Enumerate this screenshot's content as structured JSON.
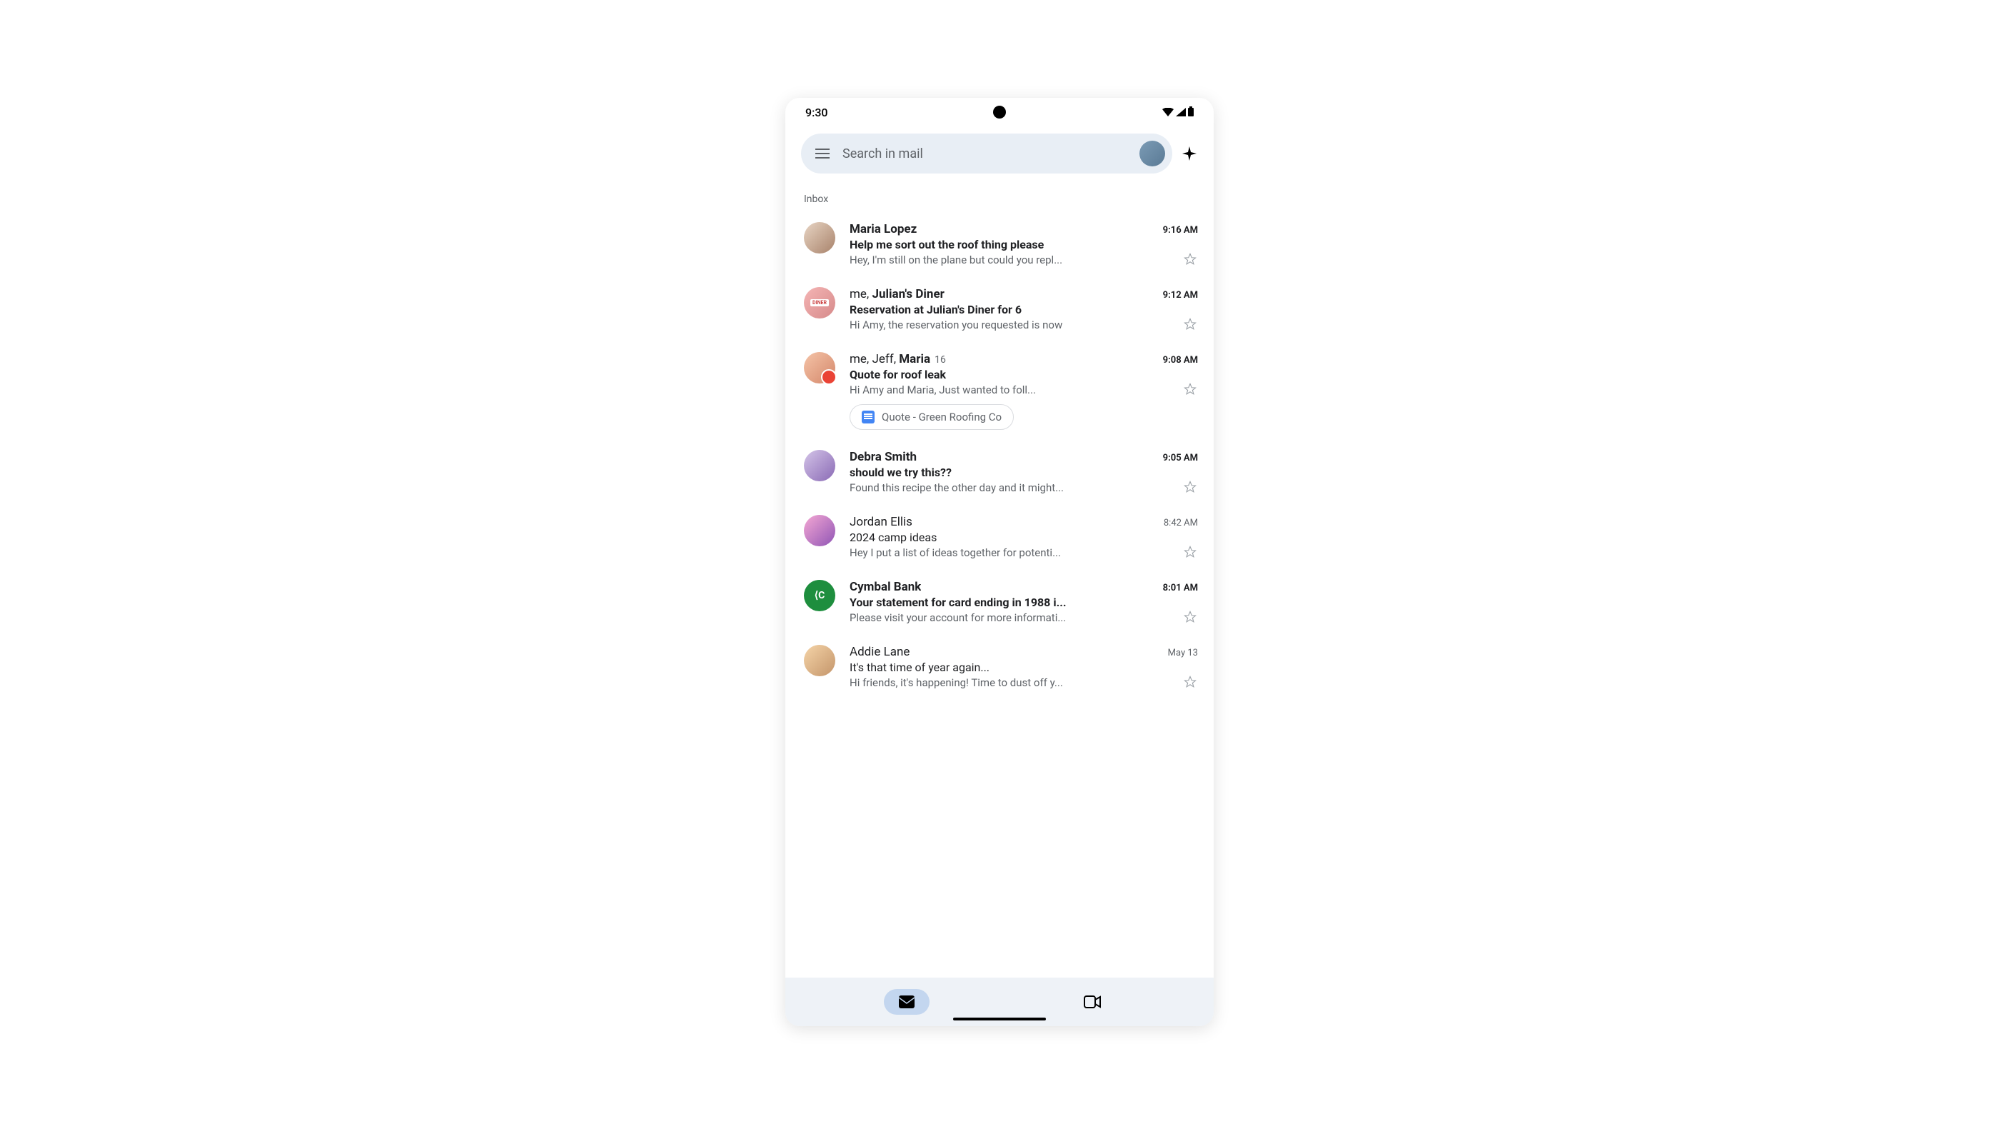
{
  "status": {
    "time": "9:30"
  },
  "search": {
    "placeholder": "Search in mail"
  },
  "section_label": "Inbox",
  "emails": [
    {
      "sender": "Maria Lopez",
      "sender_prefix": "",
      "thread_count": "",
      "time": "9:16 AM",
      "subject": "Help me sort out the roof thing please",
      "snippet": "Hey, I'm still on the plane but could you repl...",
      "unread": true,
      "starred": false,
      "attachment": null
    },
    {
      "sender": "Julian's Diner",
      "sender_prefix": "me, ",
      "thread_count": "",
      "time": "9:12 AM",
      "subject": "Reservation at Julian's Diner for 6",
      "snippet": "Hi Amy, the reservation you requested is now",
      "unread": true,
      "starred": false,
      "attachment": null
    },
    {
      "sender": "Maria",
      "sender_prefix": "me, Jeff, ",
      "thread_count": "16",
      "time": "9:08 AM",
      "subject": "Quote for roof leak",
      "snippet": "Hi Amy and Maria, Just wanted to foll...",
      "unread": true,
      "starred": false,
      "attachment": "Quote - Green Roofing Co"
    },
    {
      "sender": "Debra Smith",
      "sender_prefix": "",
      "thread_count": "",
      "time": "9:05 AM",
      "subject": "should we try this??",
      "snippet": "Found this recipe the other day and it might...",
      "unread": true,
      "starred": false,
      "attachment": null
    },
    {
      "sender": "Jordan Ellis",
      "sender_prefix": "",
      "thread_count": "",
      "time": "8:42 AM",
      "subject": "2024 camp ideas",
      "snippet": "Hey I put a list of ideas together for potenti...",
      "unread": false,
      "starred": false,
      "attachment": null
    },
    {
      "sender": "Cymbal Bank",
      "sender_prefix": "",
      "thread_count": "",
      "time": "8:01 AM",
      "subject": "Your statement for card ending in 1988 i...",
      "snippet": "Please visit your account for more informati...",
      "unread": true,
      "starred": false,
      "attachment": null
    },
    {
      "sender": "Addie Lane",
      "sender_prefix": "",
      "thread_count": "",
      "time": "May 13",
      "subject": "It's that time of year again...",
      "snippet": "Hi friends, it's happening! Time to dust off y...",
      "unread": false,
      "starred": false,
      "attachment": null
    }
  ]
}
